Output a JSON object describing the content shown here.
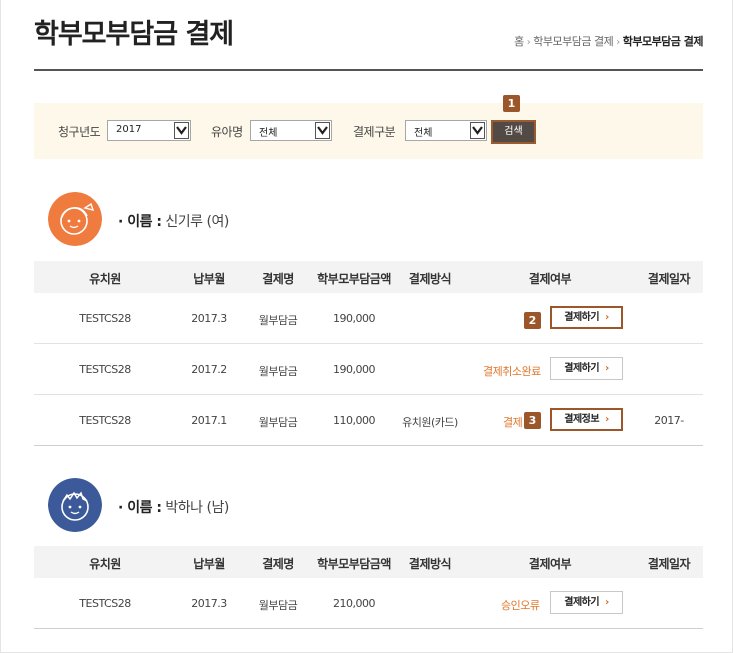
{
  "page": {
    "title": "학부모부담금 결제",
    "breadcrumb": [
      "홈",
      "학부모부담금 결제",
      "학부모부담금 결제"
    ]
  },
  "filters": {
    "year_label": "청구년도",
    "year_value": "2017",
    "child_label": "유아명",
    "child_value": "전체",
    "paytype_label": "결제구분",
    "paytype_value": "전체",
    "search_label": "검색"
  },
  "badges": [
    "1",
    "2",
    "3"
  ],
  "columns": [
    "유치원",
    "납부월",
    "결제명",
    "학부모부담금액",
    "결제방식",
    "결제여부",
    "결제일자"
  ],
  "children": [
    {
      "name_key": "· 이름 :",
      "name_value": "신기루 (여)",
      "avatar": "girl-avatar-icon",
      "rows": [
        {
          "kinder": "TESTCS28",
          "month": "2017.3",
          "item": "월부담금",
          "amount": "190,000",
          "method": "",
          "status": "",
          "button": "결제하기",
          "date": ""
        },
        {
          "kinder": "TESTCS28",
          "month": "2017.2",
          "item": "월부담금",
          "amount": "190,000",
          "method": "",
          "status": "결제취소완료",
          "button": "결제하기",
          "date": ""
        },
        {
          "kinder": "TESTCS28",
          "month": "2017.1",
          "item": "월부담금",
          "amount": "110,000",
          "method": "유치원(카드)",
          "status": "결제",
          "button": "결제정보",
          "date": "2017-"
        }
      ]
    },
    {
      "name_key": "· 이름 :",
      "name_value": "박하나 (남)",
      "avatar": "boy-avatar-icon",
      "rows": [
        {
          "kinder": "TESTCS28",
          "month": "2017.3",
          "item": "월부담금",
          "amount": "210,000",
          "method": "",
          "status": "승인오류",
          "button": "결제하기",
          "date": ""
        }
      ]
    }
  ],
  "colors": {
    "accent": "#9b562a",
    "status": "#e0762a",
    "filter_bg": "#fdf8ea",
    "girl_avatar": "#f07b3f",
    "boy_avatar": "#3c5a99"
  }
}
